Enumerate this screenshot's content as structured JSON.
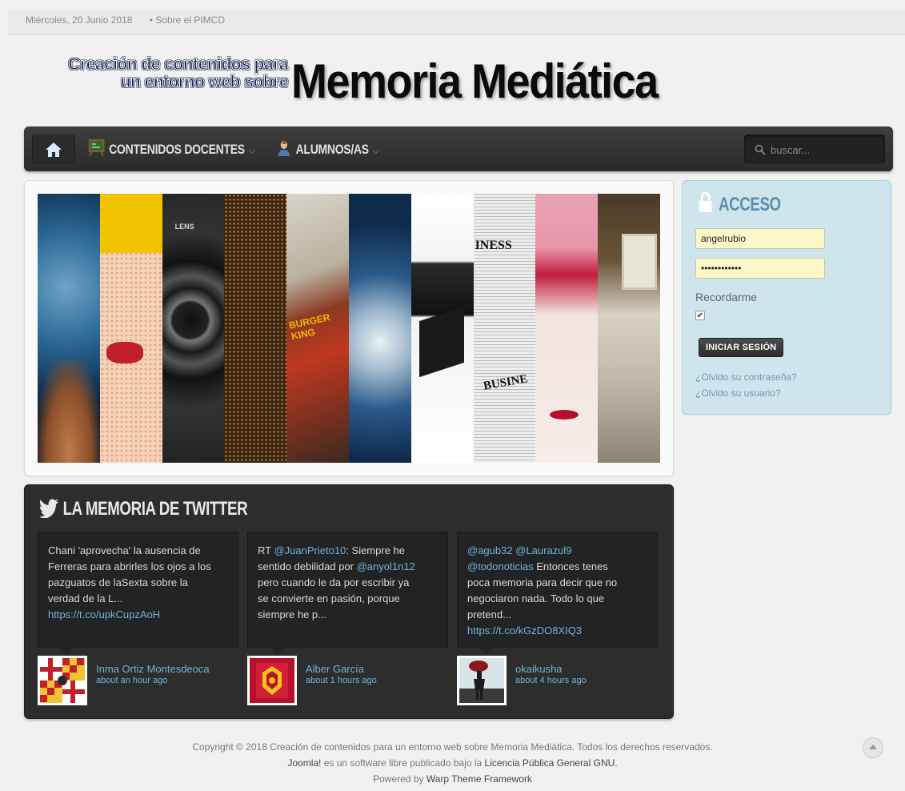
{
  "topbar": {
    "date": "Miércoles, 20 Junio 2018",
    "link": "• Sobre el PIMCD"
  },
  "logo": {
    "line1": "Creación de contenidos para",
    "line2": "un entorno web sobre",
    "title": "Memoria Mediática"
  },
  "nav": {
    "home_icon": "home-icon",
    "items": [
      {
        "label": "CONTENIDOS DOCENTES",
        "icon": "blackboard-icon"
      },
      {
        "label": "ALUMNOS/AS",
        "icon": "student-icon"
      }
    ],
    "search_placeholder": "buscar..."
  },
  "slider": {
    "strips": [
      {
        "label": ""
      },
      {
        "label": ""
      },
      {
        "label": "LENS"
      },
      {
        "label": ""
      },
      {
        "label": "BURGER KING"
      },
      {
        "label": ""
      },
      {
        "label": ""
      },
      {
        "label": "INESS"
      },
      {
        "label": ""
      },
      {
        "label": ""
      }
    ],
    "extra_label": "BUSINE"
  },
  "login": {
    "title": "ACCESO",
    "username": "angelrubio",
    "password": "••••••••••••",
    "remember_label": "Recordarme",
    "remember_checked": true,
    "submit_label": "INICIAR SESIÓN",
    "forgot_password": "¿Olvido su contraseña?",
    "forgot_username": "¿Olvido su usuario?"
  },
  "twitter": {
    "title": "LA MEMORIA DE TWITTER",
    "tweets": [
      {
        "line1": "Chani 'aprovecha' la ausencia de",
        "line2": "Ferreras para abrirles los ojos a los",
        "line3": "pazguatos de laSexta sobre la",
        "line4": "verdad de la L...",
        "link": "https://t.co/upkCupzAoH",
        "author": "Inma Ortiz Montesdeoca",
        "time": "about an hour ago"
      },
      {
        "rt": "RT ",
        "mention1": "@JuanPrieto10",
        "text1": ": Siempre he",
        "line2": "sentido debilidad por ",
        "mention2": "@anyol1n12",
        "line3": "pero cuando le da por escribir ya",
        "line4": "se convierte en pasión, porque",
        "line5": "siempre he p...",
        "author": "Alber García",
        "time": "about 1 hours ago"
      },
      {
        "mention1": "@agub32",
        "mention2": "@Laurazul9",
        "mention3": "@todonoticias",
        "text1": " Entonces tenes",
        "line3": "poca memoria para decir que no",
        "line4": "negociaron nada. Todo lo que",
        "line5": "pretend...",
        "link": "https://t.co/kGzDO8XIQ3",
        "author": "okaikusha",
        "time": "about 4 hours ago"
      }
    ]
  },
  "footer": {
    "line1": "Copyright © 2018 Creación de contenidos para un entorno web sobre Memoria Mediática. Todos los derechos reservados.",
    "joomla": "Joomla!",
    "line2_mid": " es un software libre publicado bajo la ",
    "license": "Licencia Pública General GNU.",
    "powered": "Powered by ",
    "warp": "Warp Theme Framework"
  }
}
